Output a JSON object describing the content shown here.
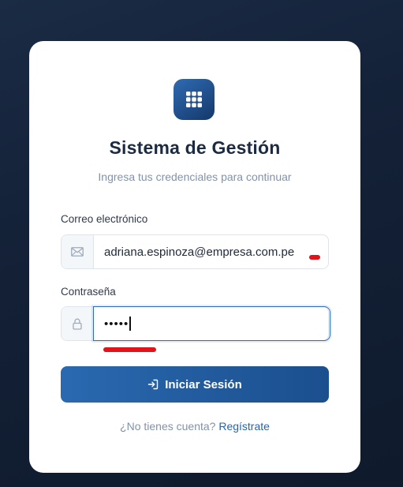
{
  "app": {
    "title": "Sistema de Gestión",
    "subtitle": "Ingresa tus credenciales para continuar"
  },
  "form": {
    "email": {
      "label": "Correo electrónico",
      "value": "adriana.espinoza@empresa.com.pe",
      "icon": "envelope-icon"
    },
    "password": {
      "label": "Contraseña",
      "value": "•••••",
      "icon": "lock-icon"
    },
    "submit_label": "Iniciar Sesión",
    "submit_icon": "sign-in-icon"
  },
  "footer": {
    "prompt": "¿No tienes cuenta?",
    "link_label": "Regístrate"
  },
  "colors": {
    "accent": "#2a69b0",
    "annotation": "#e1141b"
  }
}
